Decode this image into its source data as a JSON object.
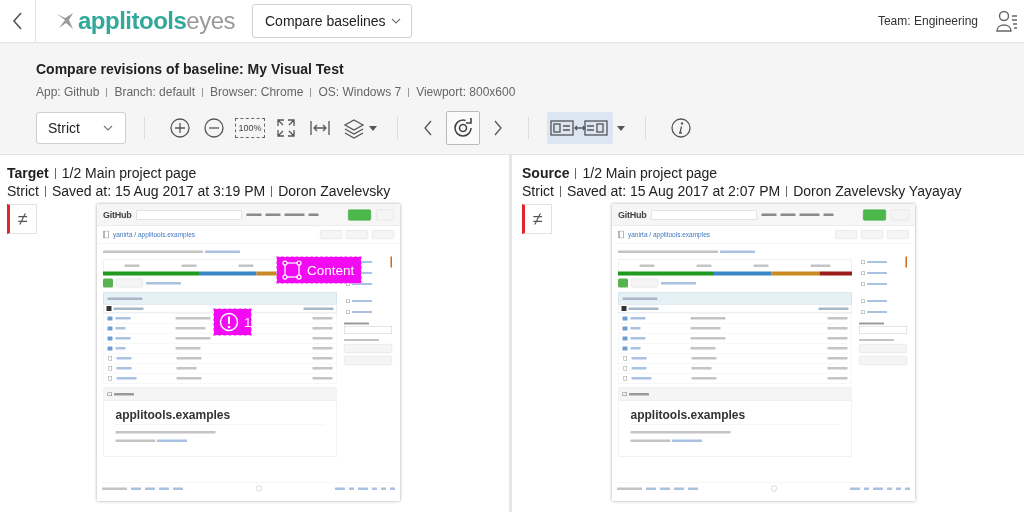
{
  "header": {
    "brand_name": "applitools",
    "brand_suffix": "eyes",
    "view_menu": "Compare baselines",
    "team": "Team: Engineering"
  },
  "info": {
    "title": "Compare revisions of baseline: My Visual Test",
    "details": [
      "App: Github",
      "Branch: default",
      "Browser: Chrome",
      "OS: Windows 7",
      "Viewport: 800x600"
    ]
  },
  "toolbar": {
    "match_level": "Strict",
    "actual_size_label": "100%",
    "diff_toggle": {
      "selected": true
    },
    "side_by_side": {
      "selected": true
    }
  },
  "panels": [
    {
      "role": "Target",
      "step": "1/2 Main project page",
      "match_level": "Strict",
      "saved": "Saved at: 15 Aug 2017 at 3:19 PM",
      "author": "Doron Zavelevsky",
      "diff_symbol": "≠",
      "different": true,
      "regions": [
        {
          "kind": "region",
          "label": "Content"
        },
        {
          "kind": "issue",
          "label": "1"
        }
      ],
      "screenshot": {
        "brand": "GitHub",
        "repo_path": "yanirta / applitools.examples",
        "readme_heading": "applitools.examples"
      }
    },
    {
      "role": "Source",
      "step": "1/2 Main project page",
      "match_level": "Strict",
      "saved": "Saved at: 15 Aug 2017 at 2:07 PM",
      "author": "Doron Zavelevsky Yayayay",
      "diff_symbol": "≠",
      "different": true,
      "screenshot": {
        "brand": "GitHub",
        "repo_path": "yanirta / applitools.examples",
        "readme_heading": "applitools.examples"
      }
    }
  ]
}
